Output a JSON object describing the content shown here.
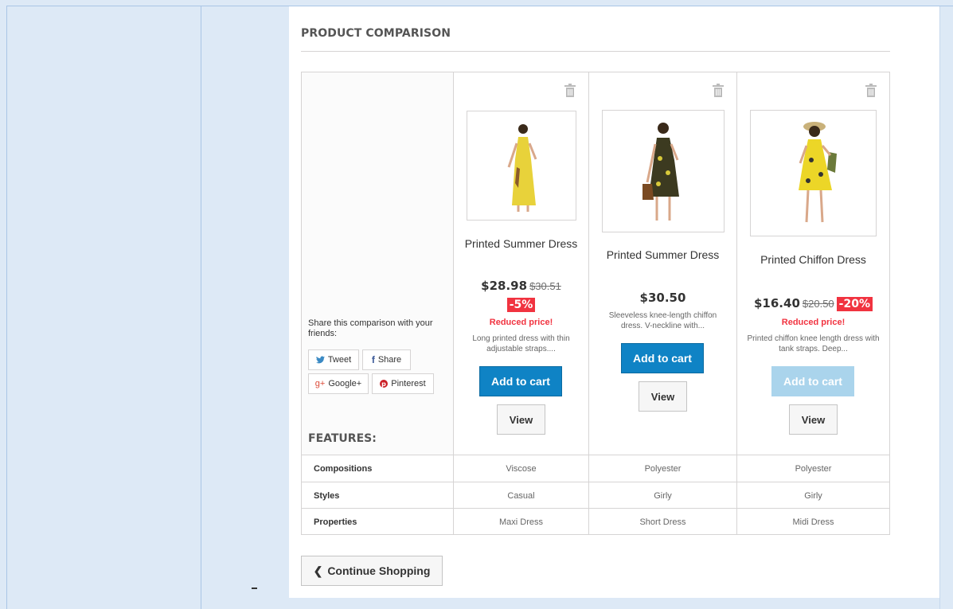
{
  "page": {
    "heading": "PRODUCT COMPARISON"
  },
  "share": {
    "text": "Share this comparison with your friends:",
    "buttons": {
      "tweet": "Tweet",
      "share": "Share",
      "google": "Google+",
      "pinterest": "Pinterest"
    }
  },
  "features_heading": "FEATURES:",
  "products": [
    {
      "name": "Printed Summer Dress",
      "price": "$28.98",
      "old_price": "$30.51",
      "discount": "-5%",
      "reduced": "Reduced price!",
      "description": "Long printed dress with thin adjustable straps....",
      "add_to_cart": "Add to cart",
      "add_to_cart_enabled": true,
      "view": "View",
      "dress_color": "#e8d23a"
    },
    {
      "name": "Printed Summer Dress",
      "price": "$30.50",
      "old_price": "",
      "discount": "",
      "reduced": "",
      "description": "Sleeveless knee-length chiffon dress. V-neckline with...",
      "add_to_cart": "Add to cart",
      "add_to_cart_enabled": true,
      "view": "View",
      "dress_color": "#3c3a20"
    },
    {
      "name": "Printed Chiffon Dress",
      "price": "$16.40",
      "old_price": "$20.50",
      "discount": "-20%",
      "reduced": "Reduced price!",
      "description": "Printed chiffon knee length dress with tank straps. Deep...",
      "add_to_cart": "Add to cart",
      "add_to_cart_enabled": false,
      "view": "View",
      "dress_color": "#ecd627"
    }
  ],
  "features": [
    {
      "name": "Compositions",
      "values": [
        "Viscose",
        "Polyester",
        "Polyester"
      ]
    },
    {
      "name": "Styles",
      "values": [
        "Casual",
        "Girly",
        "Girly"
      ]
    },
    {
      "name": "Properties",
      "values": [
        "Maxi Dress",
        "Short Dress",
        "Midi Dress"
      ]
    }
  ],
  "continue_label": "Continue Shopping",
  "colors": {
    "accent": "#0f83c5",
    "discount": "#f13340",
    "background": "#dde9f6"
  }
}
